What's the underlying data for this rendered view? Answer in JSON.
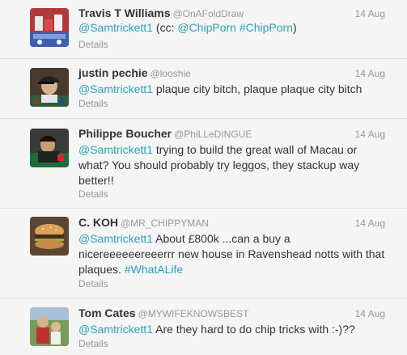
{
  "tweets": [
    {
      "name": "Travis T Williams",
      "handle": "@OnAFoldDraw",
      "time": "14 Aug",
      "mention": "@Samtrickett1",
      "text_before": " (cc: ",
      "mention2": "@ChipPorn",
      "hashtag": "#ChipPorn",
      "text_after": ")",
      "details": "Details",
      "avatar_icon": "poker-chips-avatar"
    },
    {
      "name": "justin pechie",
      "handle": "@looshie",
      "time": "14 Aug",
      "mention": "@Samtrickett1",
      "text": " plaque city bitch, plaque plaque city bitch",
      "details": "Details",
      "avatar_icon": "player-cap-avatar"
    },
    {
      "name": "Philippe Boucher",
      "handle": "@PhiLLeDINGUE",
      "time": "14 Aug",
      "mention": "@Samtrickett1",
      "text": " trying to build the great wall of Macau or what? You should probably try leggos, they stackup way better!!",
      "details": "Details",
      "avatar_icon": "player-table-avatar"
    },
    {
      "name": "C. KOH",
      "handle": "@MR_CHIPPYMAN",
      "time": "14 Aug",
      "mention": "@Samtrickett1",
      "text": " About £800k ...can a buy a nicereeeeeereeerrr new house in Ravenshead notts with that plaques. ",
      "hashtag": "#WhatALife",
      "details": "Details",
      "avatar_icon": "burger-avatar"
    },
    {
      "name": "Tom Cates",
      "handle": "@MYWIFEKNOWSBEST",
      "time": "14 Aug",
      "mention": "@Samtrickett1",
      "text": " Are they hard to do chip tricks with :-)??",
      "details": "Details",
      "avatar_icon": "family-photo-avatar"
    }
  ],
  "colors": {
    "link": "#2aa3b8",
    "name": "#333333",
    "meta": "#999999",
    "background": "#f5f5f5",
    "divider": "#e3e3e3"
  }
}
